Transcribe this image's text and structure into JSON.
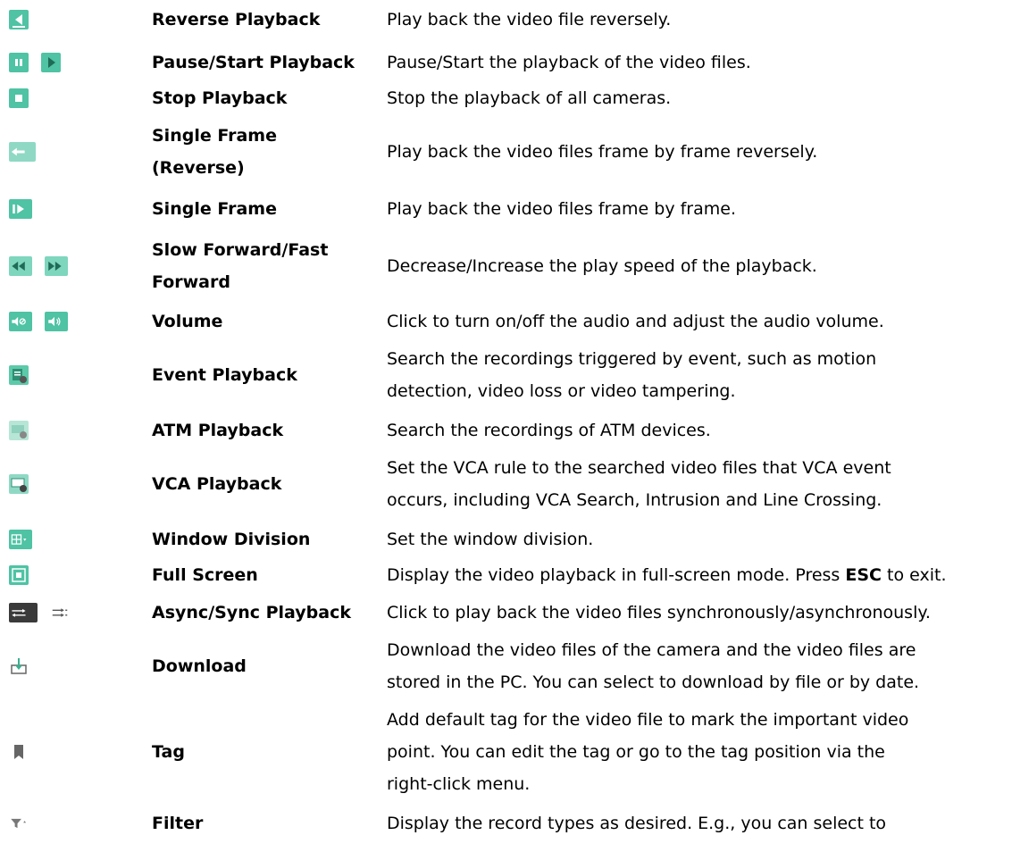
{
  "rows": [
    {
      "name": "Reverse Playback",
      "desc": [
        "Play back the video file reversely."
      ],
      "icons": [
        "reverse-playback-icon"
      ]
    },
    {
      "name": "Pause/Start Playback",
      "desc": [
        "Pause/Start the playback of the video files."
      ],
      "icons": [
        "pause-icon",
        "play-icon"
      ]
    },
    {
      "name": "Stop Playback",
      "desc": [
        "Stop the playback of all cameras."
      ],
      "icons": [
        "stop-icon"
      ]
    },
    {
      "name_lines": [
        "Single Frame",
        "(Reverse)"
      ],
      "desc": [
        "Play back the video files frame by frame reversely."
      ],
      "icons": [
        "single-frame-reverse-icon"
      ]
    },
    {
      "name": "Single Frame",
      "desc": [
        "Play back the video files frame by frame."
      ],
      "icons": [
        "single-frame-icon"
      ]
    },
    {
      "name_lines": [
        "Slow Forward/Fast",
        "Forward"
      ],
      "desc": [
        "Decrease/Increase the play speed of the playback."
      ],
      "icons": [
        "slow-forward-icon",
        "fast-forward-icon"
      ]
    },
    {
      "name": "Volume",
      "desc": [
        "Click to turn on/off the audio and adjust the audio volume."
      ],
      "icons": [
        "mute-icon",
        "volume-icon"
      ]
    },
    {
      "name": "Event Playback",
      "desc": [
        "Search the recordings triggered by event, such as motion",
        "detection, video loss or video tampering."
      ],
      "icons": [
        "event-playback-icon"
      ]
    },
    {
      "name": "ATM Playback",
      "desc": [
        "Search the recordings of ATM devices."
      ],
      "icons": [
        "atm-playback-icon"
      ]
    },
    {
      "name": "VCA Playback",
      "desc": [
        "Set the VCA rule to the searched video files that VCA event",
        "occurs, including VCA Search, Intrusion and Line Crossing."
      ],
      "icons": [
        "vca-playback-icon"
      ]
    },
    {
      "name": "Window Division",
      "desc": [
        "Set the window division."
      ],
      "icons": [
        "window-division-icon"
      ]
    },
    {
      "name": "Full Screen",
      "desc_pre": "Display the video playback in full-screen mode. Press ",
      "desc_bold": "ESC",
      "desc_post": " to exit.",
      "icons": [
        "full-screen-icon"
      ]
    },
    {
      "name": "Async/Sync Playback",
      "desc": [
        "Click to play back the video files synchronously/asynchronously."
      ],
      "icons": [
        "async-playback-icon",
        "sync-playback-icon"
      ]
    },
    {
      "name": "Download",
      "desc": [
        "Download the video files of the camera and the video files are",
        "stored in the PC. You can select to download by file or by date."
      ],
      "icons": [
        "download-icon"
      ]
    },
    {
      "name": "Tag",
      "desc": [
        "Add default tag for the video file to mark the important video",
        "point. You can edit the tag or go to the tag position via the",
        "right-click menu."
      ],
      "icons": [
        "tag-icon"
      ]
    },
    {
      "name": "Filter",
      "desc": [
        "Display the record types as desired. E.g., you can select to"
      ],
      "icons": [
        "filter-icon"
      ]
    }
  ],
  "colors": {
    "accent": "#4fc3a4",
    "gray": "#9aa0a6"
  }
}
